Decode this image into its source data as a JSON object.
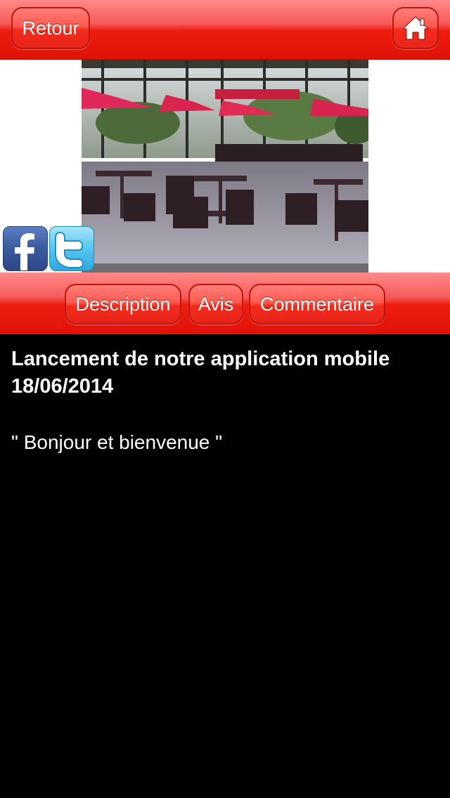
{
  "header": {
    "back_label": "Retour",
    "home_icon": "home-icon"
  },
  "photo": {
    "description": "restaurant terrace photo"
  },
  "social": {
    "facebook_icon": "facebook-icon",
    "twitter_icon": "twitter-icon"
  },
  "tabs": [
    {
      "label": "Description"
    },
    {
      "label": "Avis"
    },
    {
      "label": "Commentaire"
    }
  ],
  "content": {
    "title_line1": "Lancement de notre application mobile",
    "title_line2": "18/06/2014",
    "message": "\" Bonjour et bienvenue \""
  },
  "colors": {
    "bar_red": "#ee1d0e",
    "background": "#000000",
    "text": "#ffffff"
  }
}
